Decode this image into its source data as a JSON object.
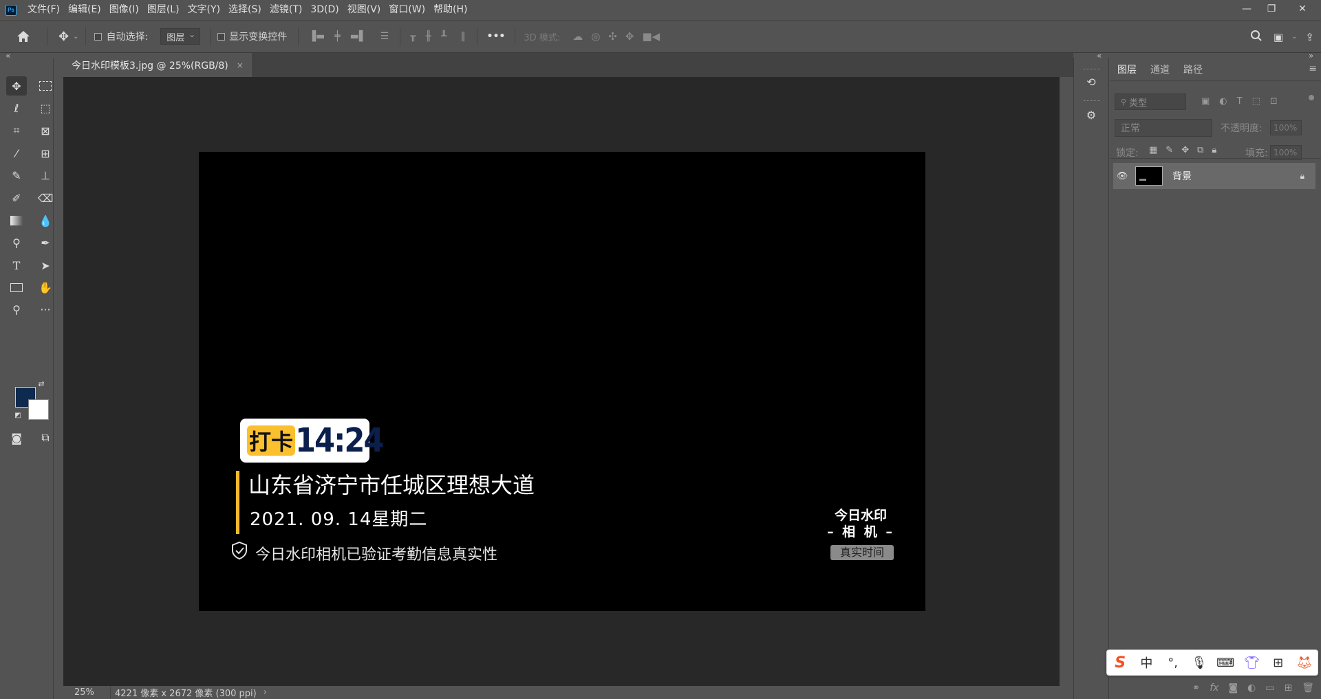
{
  "app": {
    "logo": "Ps",
    "accent": "#31a8ff"
  },
  "menubar": {
    "items": [
      "文件(F)",
      "编辑(E)",
      "图像(I)",
      "图层(L)",
      "文字(Y)",
      "选择(S)",
      "滤镜(T)",
      "3D(D)",
      "视图(V)",
      "窗口(W)",
      "帮助(H)"
    ]
  },
  "window_controls": {
    "minimize": "—",
    "restore": "❐",
    "close": "✕"
  },
  "options_bar": {
    "auto_select_label": "自动选择:",
    "auto_select_value": "图层",
    "show_transform_label": "显示变换控件",
    "more": "•••",
    "mode_3d_label": "3D 模式:"
  },
  "document": {
    "tab_title": "今日水印模板3.jpg @ 25%(RGB/8)",
    "tab_close": "×",
    "canvas_bg": "#000000"
  },
  "watermark": {
    "badge_label": "打卡",
    "badge_time": "14:24",
    "badge_label_color": "#fbc02d",
    "badge_time_color": "#0b1f4d",
    "address": "山东省济宁市任城区理想大道",
    "date": "2021. 09. 14星期二",
    "verify_text": "今日水印相机已验证考勤信息真实性",
    "brand_line1": "今日水印",
    "brand_line2": "– 相 机 –",
    "brand_tag": "真实时间"
  },
  "status_bar": {
    "zoom": "25%",
    "doc_info": "4221 像素 x 2672 像素 (300 ppi)",
    "arrow": "›"
  },
  "colors": {
    "foreground": "#0e2a4e",
    "background": "#ffffff"
  },
  "layers_panel": {
    "tabs": [
      "图层",
      "通道",
      "路径"
    ],
    "filter_placeholder": "类型",
    "blend_mode": "正常",
    "opacity_label": "不透明度:",
    "opacity_value": "100%",
    "lock_label": "锁定:",
    "fill_label": "填充:",
    "fill_value": "100%",
    "layers": [
      {
        "name": "背景",
        "visible": true,
        "locked": true
      }
    ]
  },
  "ime": {
    "items": [
      "S",
      "中",
      "°,",
      "mic-icon",
      "keyboard-icon",
      "skin-icon",
      "grid-icon",
      "toolbox-icon"
    ],
    "zh_label": "中",
    "punct_label": "°,"
  }
}
